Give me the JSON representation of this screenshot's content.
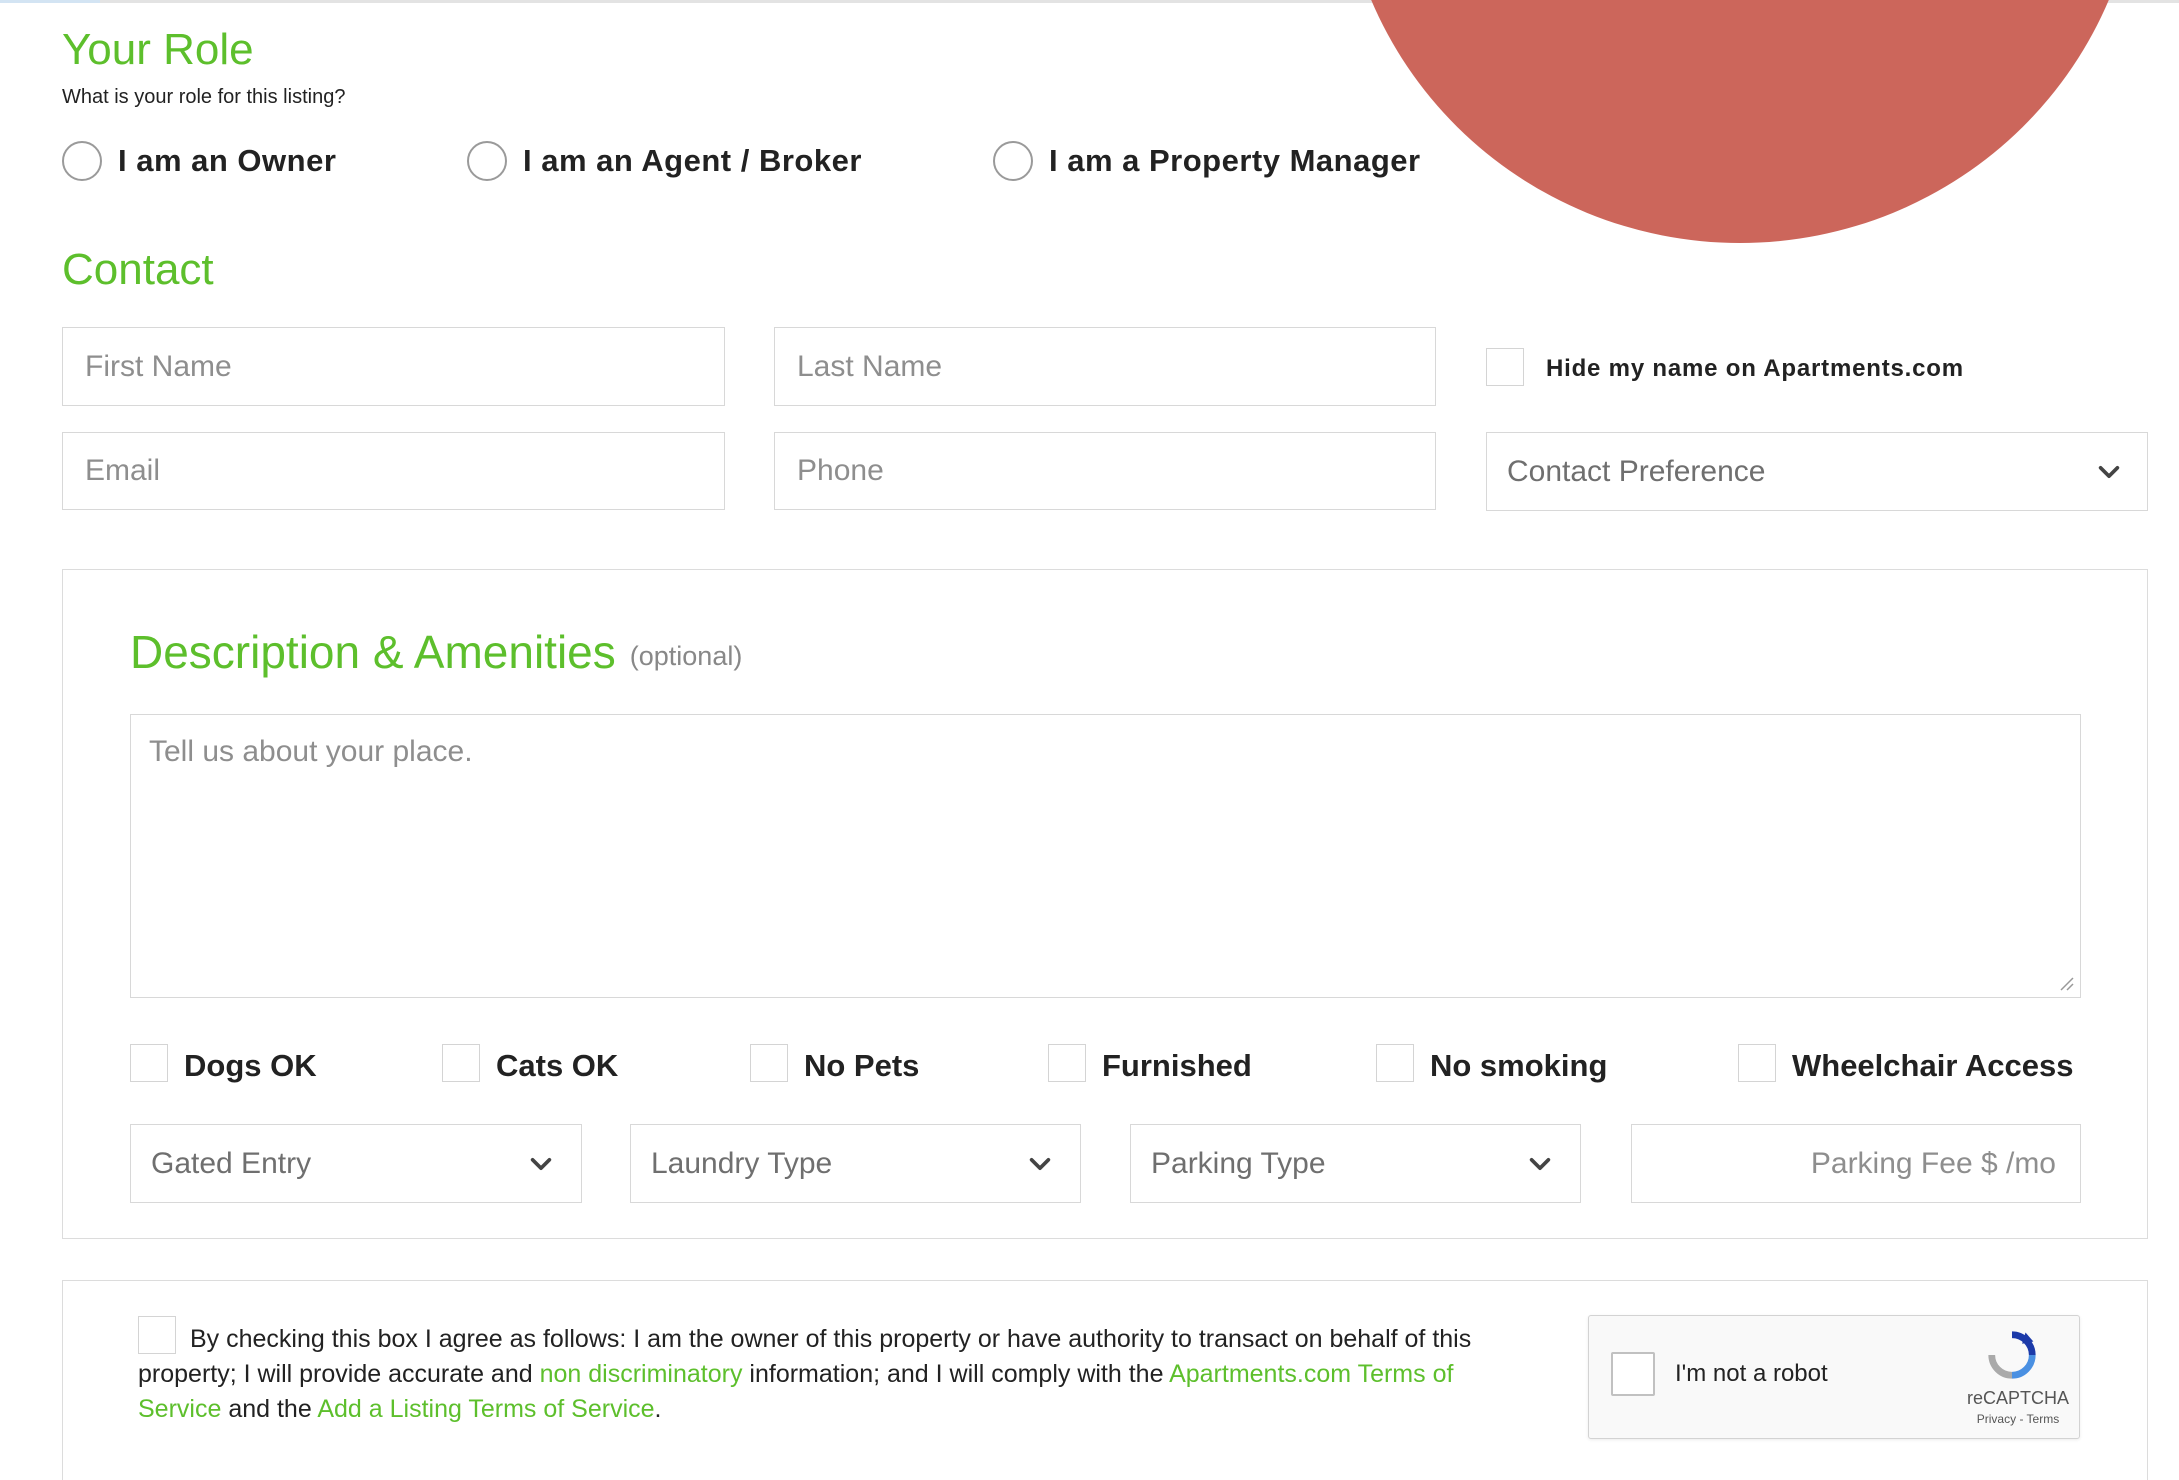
{
  "role": {
    "title": "Your Role",
    "subtitle": "What is your role for this listing?",
    "options": [
      "I am an Owner",
      "I am an Agent / Broker",
      "I am a Property Manager"
    ]
  },
  "contact": {
    "title": "Contact",
    "first_name_placeholder": "First Name",
    "last_name_placeholder": "Last Name",
    "email_placeholder": "Email",
    "phone_placeholder": "Phone",
    "hide_name_label": "Hide my name on Apartments.com",
    "contact_preference": "Contact Preference"
  },
  "description": {
    "title": "Description & Amenities",
    "optional": "(optional)",
    "placeholder": "Tell us about your place.",
    "amenities": [
      "Dogs OK",
      "Cats OK",
      "No Pets",
      "Furnished",
      "No smoking",
      "Wheelchair Access"
    ],
    "gated_entry": "Gated Entry",
    "laundry_type": "Laundry Type",
    "parking_type": "Parking Type",
    "parking_fee_placeholder": "Parking Fee $ /mo"
  },
  "agreement": {
    "text_1": "By checking this box I agree as follows: I am the owner of this property or have authority to transact on behalf of this property; I will provide accurate and",
    "link_non_discriminatory": "non discriminatory",
    "text_2": "information; and I will comply with the",
    "link_tos": "Apartments.com Terms of Service",
    "text_3": "and the",
    "link_listing_tos": "Add a Listing Terms of Service",
    "text_4": "."
  },
  "captcha": {
    "label": "I'm not a robot",
    "brand": "reCAPTCHA",
    "terms": "Privacy - Terms"
  },
  "colors": {
    "accent_green": "#5dbf2c",
    "blob_red": "#cc665b"
  }
}
